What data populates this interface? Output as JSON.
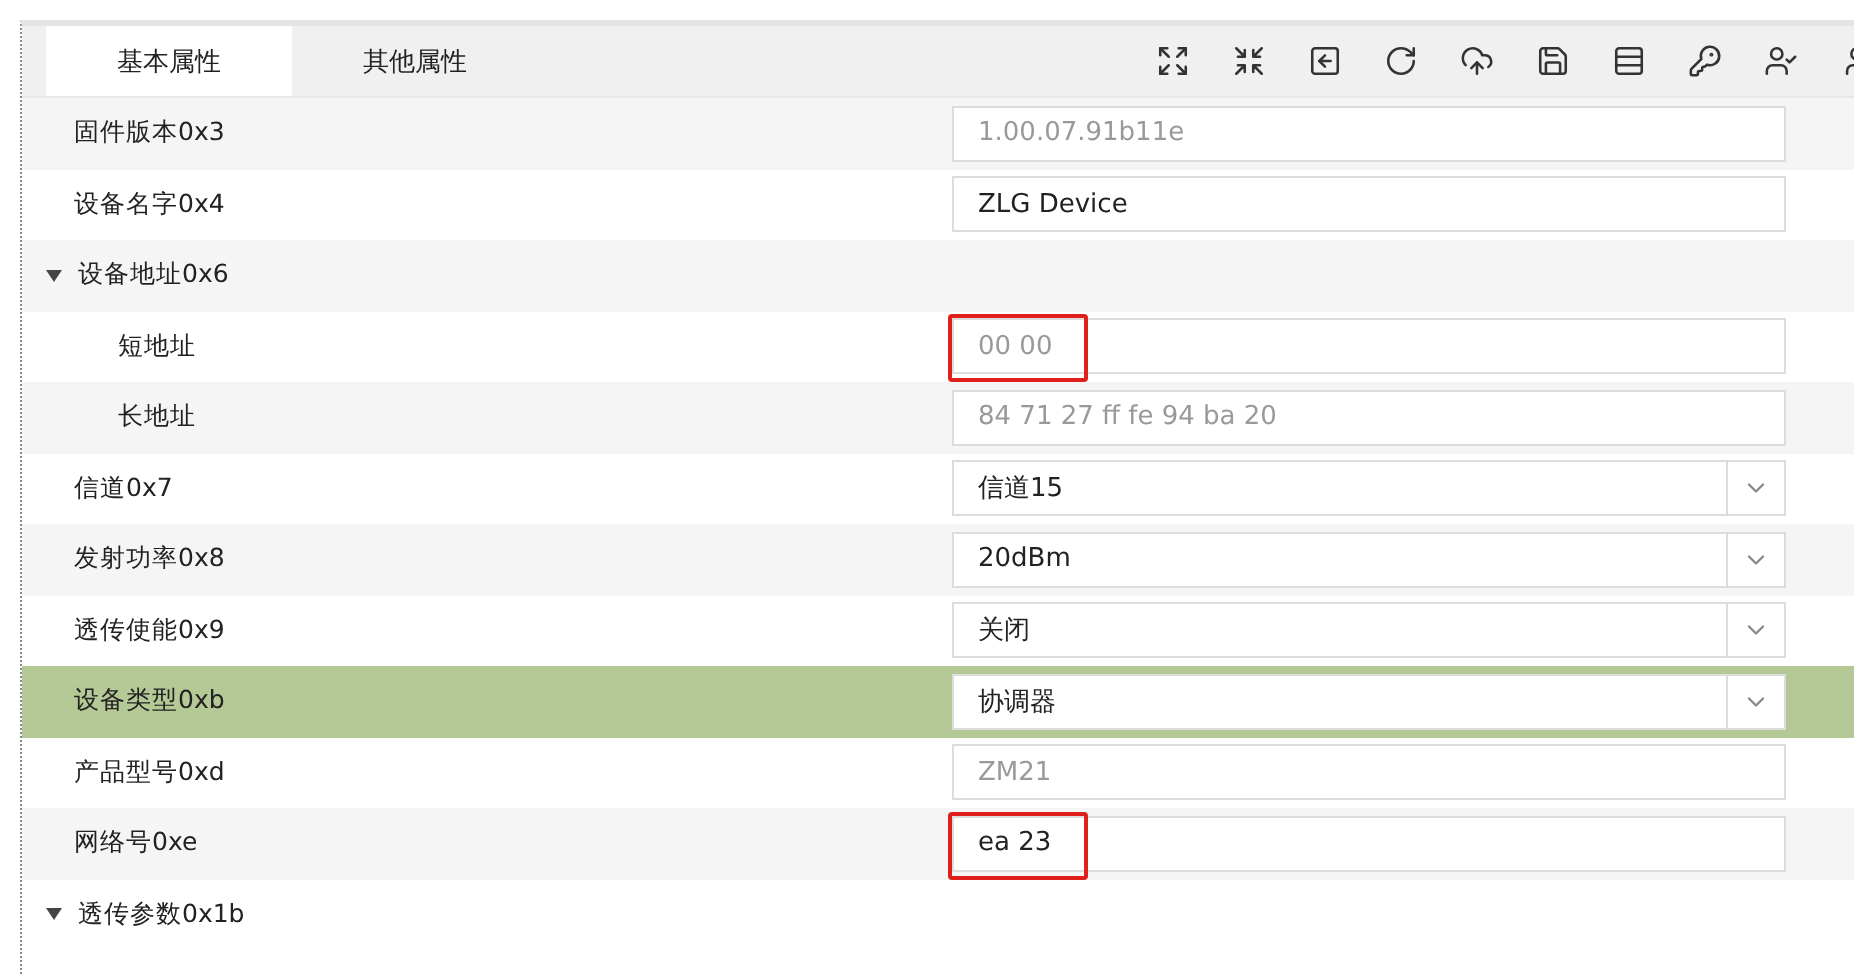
{
  "tabs": [
    {
      "label": "基本属性",
      "selected": true
    },
    {
      "label": "其他属性",
      "selected": false
    }
  ],
  "properties": [
    {
      "label": "固件版本0x3",
      "kind": "text",
      "readonly": true,
      "value": "1.00.07.91b11e",
      "highlighted": false
    },
    {
      "label": "设备名字0x4",
      "kind": "text",
      "readonly": false,
      "value": "ZLG Device",
      "highlighted": false
    },
    {
      "label": "设备地址0x6",
      "kind": "group",
      "expanded": true,
      "children": [
        {
          "label": "短地址",
          "kind": "text",
          "readonly": true,
          "value": "00 00",
          "highlighted": true
        },
        {
          "label": "长地址",
          "kind": "text",
          "readonly": true,
          "value": "84 71 27 ff fe 94 ba 20",
          "highlighted": false
        }
      ]
    },
    {
      "label": "信道0x7",
      "kind": "select",
      "value": "信道15",
      "selected": false
    },
    {
      "label": "发射功率0x8",
      "kind": "select",
      "value": "20dBm",
      "selected": false
    },
    {
      "label": "透传使能0x9",
      "kind": "select",
      "value": "关闭",
      "selected": false
    },
    {
      "label": "设备类型0xb",
      "kind": "select",
      "value": "协调器",
      "selected": true
    },
    {
      "label": "产品型号0xd",
      "kind": "text",
      "readonly": true,
      "value": "ZM21",
      "highlighted": false
    },
    {
      "label": "网络号0xe",
      "kind": "text",
      "readonly": false,
      "value": "ea 23",
      "highlighted": true
    },
    {
      "label": "透传参数0x1b",
      "kind": "group",
      "expanded": true
    }
  ]
}
